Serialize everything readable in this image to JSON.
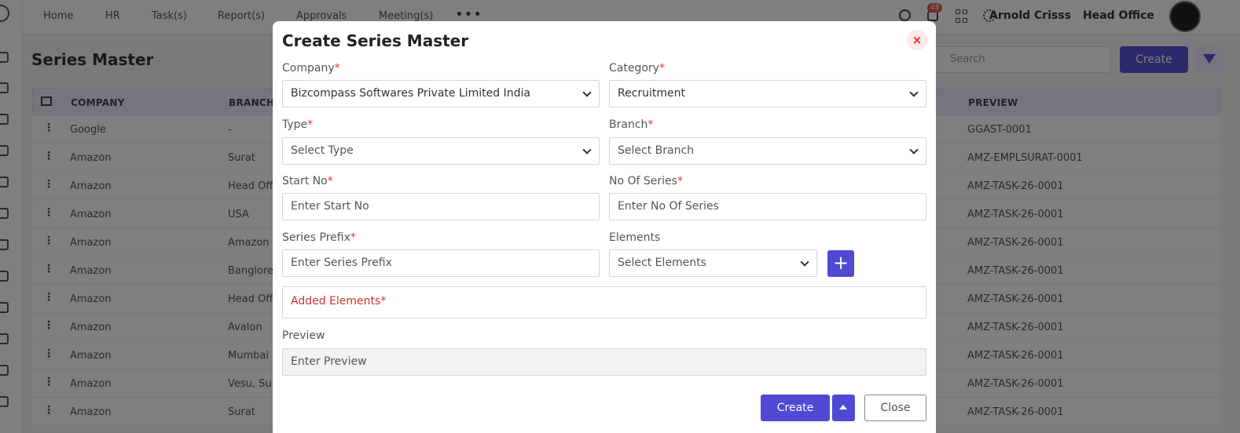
{
  "topnav": {
    "items": [
      "Home",
      "HR",
      "Task(s)",
      "Report(s)",
      "Approvals",
      "Meeting(s)"
    ],
    "more": "•••",
    "notification_count": "48",
    "user_name": "Arnold Crisss",
    "office": "Head Office"
  },
  "page": {
    "title": "Series Master",
    "search_placeholder": "Search",
    "create_label": "Create"
  },
  "table": {
    "headers": {
      "company": "COMPANY",
      "branch": "BRANCH",
      "preview": "PREVIEW"
    },
    "rows": [
      {
        "company": "Google",
        "branch": "-",
        "preview": "GGAST-0001"
      },
      {
        "company": "Amazon",
        "branch": "Surat",
        "preview": "AMZ-EMPLSURAT-0001"
      },
      {
        "company": "Amazon",
        "branch": "Head Off",
        "preview": "AMZ-TASK-26-0001"
      },
      {
        "company": "Amazon",
        "branch": "USA",
        "preview": "AMZ-TASK-26-0001"
      },
      {
        "company": "Amazon",
        "branch": "Amazon",
        "preview": "AMZ-TASK-26-0001"
      },
      {
        "company": "Amazon",
        "branch": "Banglore",
        "preview": "AMZ-TASK-26-0001"
      },
      {
        "company": "Amazon",
        "branch": "Head Off",
        "preview": "AMZ-TASK-26-0001"
      },
      {
        "company": "Amazon",
        "branch": "Avalon",
        "preview": "AMZ-TASK-26-0001"
      },
      {
        "company": "Amazon",
        "branch": "Mumbai",
        "preview": "AMZ-TASK-26-0001"
      },
      {
        "company": "Amazon",
        "branch": "Vesu, Su",
        "preview": "AMZ-TASK-26-0001"
      },
      {
        "company": "Amazon",
        "branch": "Surat",
        "preview": "AMZ-TASK-26-0001"
      }
    ]
  },
  "modal": {
    "title": "Create Series Master",
    "close_icon": "×",
    "required_mark": "*",
    "company": {
      "label": "Company",
      "value": "Bizcompass Softwares Private Limited India"
    },
    "category": {
      "label": "Category",
      "value": "Recruitment"
    },
    "type": {
      "label": "Type",
      "placeholder": "Select Type"
    },
    "branch": {
      "label": "Branch",
      "placeholder": "Select Branch"
    },
    "start_no": {
      "label": "Start No",
      "placeholder": "Enter Start No"
    },
    "no_of_series": {
      "label": "No Of Series",
      "placeholder": "Enter No Of Series"
    },
    "series_prefix": {
      "label": "Series Prefix",
      "placeholder": "Enter Series Prefix"
    },
    "elements": {
      "label": "Elements",
      "placeholder": "Select Elements",
      "add_icon": "+"
    },
    "added_elements": {
      "label": "Added Elements"
    },
    "preview": {
      "label": "Preview",
      "placeholder": "Enter Preview"
    },
    "buttons": {
      "create": "Create",
      "close": "Close"
    }
  },
  "colors": {
    "primary": "#4f49d4",
    "required": "#e03030",
    "overlay": "rgba(0,0,0,0.5)"
  }
}
